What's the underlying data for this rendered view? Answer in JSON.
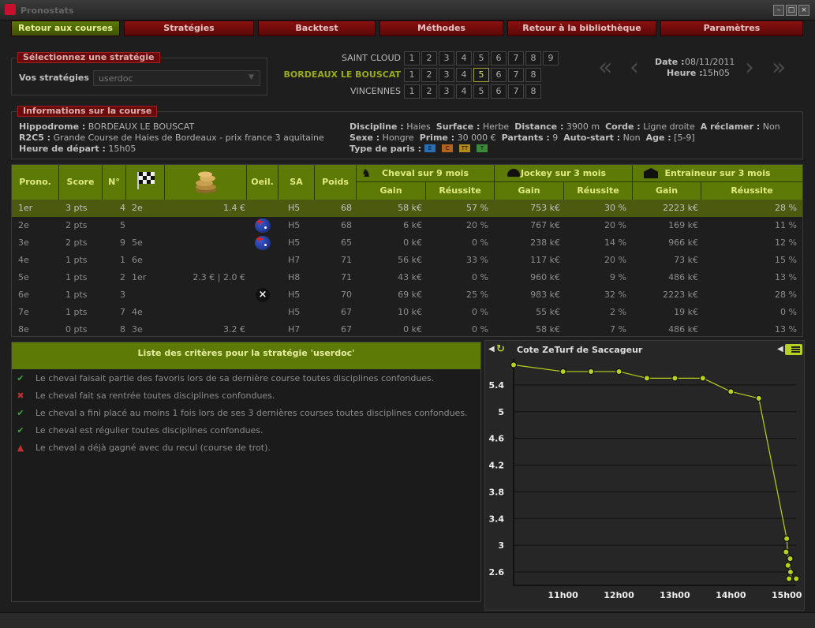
{
  "app": {
    "title": "Pronostats"
  },
  "toolbar": {
    "buttons": [
      "Retour aux courses",
      "Stratégies",
      "Backtest",
      "Méthodes",
      "Retour à la bibliothèque",
      "Paramètres"
    ]
  },
  "strategy": {
    "section_title": "Sélectionnez une stratégie",
    "label": "Vos stratégies",
    "selected": "userdoc"
  },
  "meetings": [
    {
      "name": "SAINT CLOUD",
      "races": [
        "1",
        "2",
        "3",
        "4",
        "5",
        "6",
        "7",
        "8",
        "9"
      ],
      "selected": null
    },
    {
      "name": "BORDEAUX LE BOUSCAT",
      "races": [
        "1",
        "2",
        "3",
        "4",
        "5",
        "6",
        "7",
        "8"
      ],
      "selected": "5"
    },
    {
      "name": "VINCENNES",
      "races": [
        "1",
        "2",
        "3",
        "4",
        "5",
        "6",
        "7",
        "8"
      ],
      "selected": null
    }
  ],
  "datebox": {
    "date_label": "Date :",
    "date": "08/11/2011",
    "hour_label": "Heure :",
    "hour": "15h05"
  },
  "info": {
    "section_title": "Informations sur la course",
    "hippodrome_label": "Hippodrome :",
    "hippodrome": "BORDEAUX LE BOUSCAT",
    "race_code_label": "R2C5 :",
    "race_name": "Grande Course de Haies de Bordeaux - prix france 3 aquitaine",
    "start_label": "Heure de départ :",
    "start": "15h05",
    "discipline_label": "Discipline :",
    "discipline": "Haies",
    "surface_label": "Surface :",
    "surface": "Herbe",
    "distance_label": "Distance :",
    "distance": "3900 m",
    "corde_label": "Corde :",
    "corde": "Ligne droite",
    "reclamer_label": "A réclamer :",
    "reclamer": "Non",
    "sexe_label": "Sexe :",
    "sexe": "Hongre",
    "prime_label": "Prime :",
    "prime": "30 000 €",
    "partants_label": "Partants :",
    "partants": "9",
    "autostart_label": "Auto-start :",
    "autostart": "Non",
    "age_label": "Age :",
    "age": "[5-9]",
    "paris_label": "Type de paris :",
    "paris": [
      {
        "code": "E",
        "color": "#2a6fb5"
      },
      {
        "code": "C",
        "color": "#b5621a"
      },
      {
        "code": "TT",
        "color": "#b58a1a"
      },
      {
        "code": "T",
        "color": "#3a8a3a"
      }
    ]
  },
  "table": {
    "headers": {
      "prono": "Prono.",
      "score": "Score",
      "num": "N°",
      "oeil": "Oeil.",
      "sa": "SA",
      "poids": "Poids",
      "cheval": "Cheval sur 9 mois",
      "jockey": "Jockey sur 3 mois",
      "entraineur": "Entraineur sur 3 mois",
      "gain": "Gain",
      "reussite": "Réussite"
    },
    "rows": [
      {
        "prono": "1er",
        "score": "3 pts",
        "num": "4",
        "last": "2e",
        "cote": "1.4 €",
        "oeil": "",
        "sa": "H5",
        "poids": "68",
        "cg": "58 k€",
        "cr": "57 %",
        "jg": "753 k€",
        "jr": "30 %",
        "eg": "2223 k€",
        "er": "28 %"
      },
      {
        "prono": "2e",
        "score": "2 pts",
        "num": "5",
        "last": "",
        "cote": "",
        "oeil": "flag",
        "sa": "H5",
        "poids": "68",
        "cg": "6 k€",
        "cr": "20 %",
        "jg": "767 k€",
        "jr": "20 %",
        "eg": "169 k€",
        "er": "11 %"
      },
      {
        "prono": "3e",
        "score": "2 pts",
        "num": "9",
        "last": "5e",
        "cote": "",
        "oeil": "flag",
        "sa": "H5",
        "poids": "65",
        "cg": "0 k€",
        "cr": "0 %",
        "jg": "238 k€",
        "jr": "14 %",
        "eg": "966 k€",
        "er": "12 %"
      },
      {
        "prono": "4e",
        "score": "1 pts",
        "num": "1",
        "last": "6e",
        "cote": "",
        "oeil": "",
        "sa": "H7",
        "poids": "71",
        "cg": "56 k€",
        "cr": "33 %",
        "jg": "117 k€",
        "jr": "20 %",
        "eg": "73 k€",
        "er": "15 %"
      },
      {
        "prono": "5e",
        "score": "1 pts",
        "num": "2",
        "last": "1er",
        "cote": "2.3 € | 2.0 €",
        "oeil": "",
        "sa": "H8",
        "poids": "71",
        "cg": "43 k€",
        "cr": "0 %",
        "jg": "960 k€",
        "jr": "9 %",
        "eg": "486 k€",
        "er": "13 %"
      },
      {
        "prono": "6e",
        "score": "1 pts",
        "num": "3",
        "last": "",
        "cote": "",
        "oeil": "x",
        "sa": "H5",
        "poids": "70",
        "cg": "69 k€",
        "cr": "25 %",
        "jg": "983 k€",
        "jr": "32 %",
        "eg": "2223 k€",
        "er": "28 %"
      },
      {
        "prono": "7e",
        "score": "1 pts",
        "num": "7",
        "last": "4e",
        "cote": "",
        "oeil": "",
        "sa": "H5",
        "poids": "67",
        "cg": "10 k€",
        "cr": "0 %",
        "jg": "55 k€",
        "jr": "2 %",
        "eg": "19 k€",
        "er": "0 %"
      },
      {
        "prono": "8e",
        "score": "0 pts",
        "num": "8",
        "last": "3e",
        "cote": "3.2 €",
        "oeil": "",
        "sa": "H7",
        "poids": "67",
        "cg": "0 k€",
        "cr": "0 %",
        "jg": "58 k€",
        "jr": "7 %",
        "eg": "486 k€",
        "er": "13 %"
      }
    ]
  },
  "criteria": {
    "title": "Liste des critères pour la stratégie 'userdoc'",
    "items": [
      {
        "status": "ok",
        "text": "Le cheval faisait partie des favoris lors de sa dernière course toutes disciplines confondues."
      },
      {
        "status": "fail",
        "text": "Le cheval fait sa rentrée toutes disciplines confondues."
      },
      {
        "status": "ok",
        "text": "Le cheval a fini placé au moins 1 fois lors de ses 3 dernières courses toutes disciplines confondues."
      },
      {
        "status": "ok",
        "text": "Le cheval est régulier toutes disciplines confondues."
      },
      {
        "status": "warn",
        "text": "Le cheval a déjà gagné avec du recul (course de trot)."
      }
    ]
  },
  "colors": {
    "accent": "#5d7a06",
    "line": "#b8d020",
    "tab_red": "#7a0e0e"
  },
  "chart_data": {
    "type": "line",
    "title": "Cote ZeTurf de Saccageur",
    "xlabel": "",
    "ylabel": "",
    "xticks": [
      "11h00",
      "12h00",
      "13h00",
      "14h00",
      "15h00"
    ],
    "yticks": [
      "2.6",
      "3",
      "3.4",
      "3.8",
      "4.2",
      "4.6",
      "5",
      "5.4"
    ],
    "ylim": [
      2.4,
      5.8
    ],
    "x": [
      "10h07",
      "11h00",
      "11h30",
      "12h00",
      "12h30",
      "13h00",
      "13h30",
      "14h00",
      "14h30",
      "15h00",
      "15h01",
      "15h02",
      "15h03",
      "15h04",
      "15h05",
      "15h06"
    ],
    "values": [
      5.7,
      5.6,
      5.6,
      5.6,
      5.5,
      5.5,
      5.5,
      5.3,
      5.2,
      3.1,
      2.9,
      2.8,
      2.7,
      2.6,
      2.5,
      2.5
    ]
  }
}
